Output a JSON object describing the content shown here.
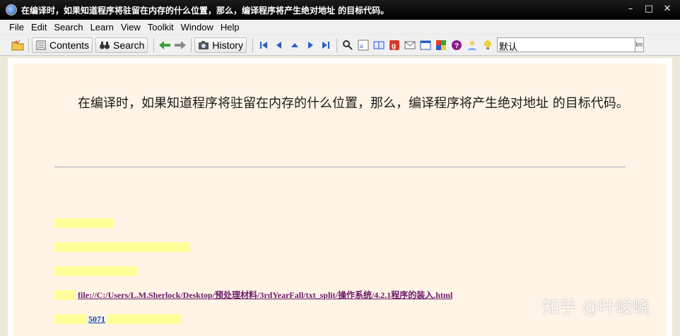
{
  "window": {
    "title": "在编译时，如果知道程序将驻留在内存的什么位置，那么，编译程序将产生绝对地址 的目标代码。",
    "controls": {
      "minimize": "–",
      "maximize": "□",
      "close": "✕"
    }
  },
  "menu": [
    "File",
    "Edit",
    "Search",
    "Learn",
    "View",
    "Toolkit",
    "Window",
    "Help"
  ],
  "toolbar": {
    "contents_label": "Contents",
    "search_label": "Search",
    "history_label": "History",
    "search_value": "默认",
    "search_go_label": "Im",
    "icons": [
      "open-folder-icon",
      "back-arrow-icon",
      "forward-arrow-icon",
      "first-page-icon",
      "prev-page-icon",
      "up-icon",
      "next-page-icon",
      "last-page-icon",
      "find-icon",
      "font-icon",
      "book-icon",
      "google-icon",
      "mail-icon",
      "window-icon",
      "color-icon",
      "help-icon",
      "user-icon",
      "bulb-icon"
    ],
    "colors": {
      "accent_green": "#3ca03c",
      "nav_blue": "#2a5cc8"
    }
  },
  "content": {
    "paragraph": "在编译时，如果知道程序将驻留在内存的什么位置，那么，编译程序将产生绝对地址 的目标代码。",
    "meta": {
      "url_text": "file://C:/Users/L.M.Sherlock/Desktop/预处理材料/3rdYearFall/txt_split/操作系统/4.2.1程序的装入.html",
      "number": "5071"
    }
  },
  "watermark": "知乎 @叶峻峣"
}
